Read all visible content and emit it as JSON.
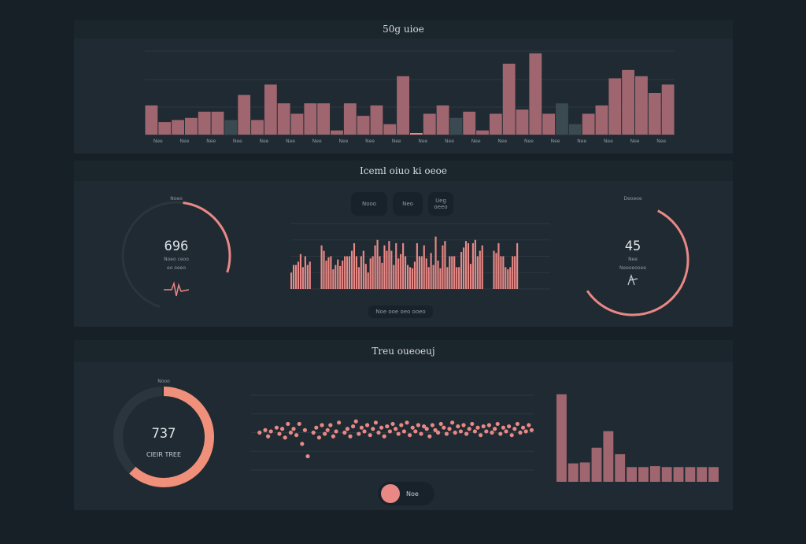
{
  "colors": {
    "background": "#182027",
    "panel": "#1f2a32",
    "bar": "#a06670",
    "bar_muted": "#3a4a50",
    "accent": "#e98885",
    "accent_orange": "#f0907a",
    "track": "#2a353c"
  },
  "panel1": {
    "title": "50g uioe"
  },
  "panel2": {
    "title": "Iceml oiuo ki oeoe",
    "gauge_left": {
      "label": "Noeo",
      "value": "696",
      "caption1": "Noeo ceoo",
      "caption2": "eo oeeo"
    },
    "gauge_right": {
      "label": "Deoeoe",
      "value": "45",
      "caption1": "Nee",
      "caption2": "Neeoeooee"
    },
    "buttons": [
      "Nooo",
      "Neo",
      "Ueg"
    ],
    "button_sub": "oeeo",
    "footer": "Noe ooe oeo ooeo"
  },
  "panel3": {
    "title": "Treu oueoeuj",
    "donut": {
      "label": "Nooo",
      "value": "737",
      "caption": "CIEIR TREE"
    },
    "toggle_label": "Noe"
  },
  "chart_data": [
    {
      "type": "bar",
      "title": "50g uioe",
      "ylim": [
        0,
        40
      ],
      "categories": [
        "Nee",
        "Nee",
        "Nee",
        "Nee",
        "Nee",
        "Nee",
        "Nee",
        "Nee",
        "Nee",
        "Nee",
        "Nee",
        "Nee",
        "Nee",
        "Nee",
        "Nee",
        "Nee",
        "Nee",
        "Nee",
        "Nee",
        "Nee"
      ],
      "values": [
        14,
        6,
        7,
        8,
        11,
        11,
        7,
        19,
        7,
        24,
        15,
        10,
        15,
        15,
        2,
        15,
        9,
        14,
        5,
        28,
        19,
        10,
        14,
        8,
        11,
        2,
        10,
        34,
        12,
        39,
        10,
        15,
        5,
        10,
        14,
        27,
        31,
        28,
        20,
        24
      ],
      "muted_indices": [
        6,
        23,
        31,
        32
      ],
      "highlight_index": 20,
      "grid": true
    },
    {
      "type": "bar",
      "ylim": [
        0,
        60
      ],
      "values": [
        15,
        22,
        22,
        25,
        32,
        20,
        30,
        22,
        25,
        40,
        35,
        26,
        29,
        30,
        18,
        22,
        27,
        21,
        26,
        30,
        30,
        30,
        35,
        42,
        30,
        20,
        30,
        35,
        23,
        15,
        28,
        30,
        40,
        45,
        30,
        24,
        40,
        35,
        44,
        35,
        22,
        42,
        28,
        32,
        42,
        30,
        22,
        20,
        19,
        25,
        42,
        30,
        30,
        40,
        28,
        20,
        33,
        22,
        48,
        26,
        19,
        40,
        44,
        20,
        30,
        30,
        30,
        20,
        20,
        34,
        38,
        44,
        42,
        23,
        42,
        45,
        30,
        35,
        40,
        35,
        33,
        42,
        30,
        30,
        20,
        18,
        20,
        30,
        30,
        42
      ],
      "gaps_after": [
        8,
        78
      ],
      "grid": true
    },
    {
      "type": "scatter",
      "ylim": [
        0,
        60
      ],
      "xlim": [
        0,
        100
      ],
      "points": [
        [
          3,
          30
        ],
        [
          5,
          32
        ],
        [
          6,
          27
        ],
        [
          7,
          31
        ],
        [
          9,
          34
        ],
        [
          10,
          29
        ],
        [
          11,
          33
        ],
        [
          12,
          26
        ],
        [
          13,
          37
        ],
        [
          14,
          30
        ],
        [
          15,
          33
        ],
        [
          16,
          28
        ],
        [
          17,
          37
        ],
        [
          18,
          21
        ],
        [
          19,
          32
        ],
        [
          20,
          11
        ],
        [
          22,
          30
        ],
        [
          23,
          34
        ],
        [
          24,
          26
        ],
        [
          25,
          36
        ],
        [
          26,
          29
        ],
        [
          27,
          32
        ],
        [
          28,
          36
        ],
        [
          29,
          27
        ],
        [
          30,
          31
        ],
        [
          31,
          38
        ],
        [
          33,
          30
        ],
        [
          34,
          33
        ],
        [
          35,
          27
        ],
        [
          36,
          35
        ],
        [
          37,
          39
        ],
        [
          38,
          29
        ],
        [
          39,
          34
        ],
        [
          40,
          31
        ],
        [
          41,
          36
        ],
        [
          42,
          28
        ],
        [
          43,
          33
        ],
        [
          44,
          38
        ],
        [
          45,
          30
        ],
        [
          46,
          34
        ],
        [
          47,
          27
        ],
        [
          48,
          35
        ],
        [
          49,
          31
        ],
        [
          50,
          37
        ],
        [
          51,
          33
        ],
        [
          52,
          29
        ],
        [
          53,
          36
        ],
        [
          54,
          31
        ],
        [
          55,
          38
        ],
        [
          56,
          28
        ],
        [
          57,
          34
        ],
        [
          58,
          31
        ],
        [
          59,
          36
        ],
        [
          60,
          29
        ],
        [
          61,
          35
        ],
        [
          62,
          33
        ],
        [
          63,
          27
        ],
        [
          64,
          36
        ],
        [
          65,
          32
        ],
        [
          66,
          30
        ],
        [
          67,
          37
        ],
        [
          68,
          34
        ],
        [
          69,
          29
        ],
        [
          70,
          33
        ],
        [
          71,
          38
        ],
        [
          72,
          30
        ],
        [
          73,
          35
        ],
        [
          74,
          31
        ],
        [
          75,
          36
        ],
        [
          76,
          29
        ],
        [
          77,
          33
        ],
        [
          78,
          37
        ],
        [
          79,
          31
        ],
        [
          80,
          34
        ],
        [
          81,
          28
        ],
        [
          82,
          35
        ],
        [
          83,
          31
        ],
        [
          84,
          36
        ],
        [
          85,
          30
        ],
        [
          86,
          33
        ],
        [
          87,
          37
        ],
        [
          88,
          29
        ],
        [
          89,
          34
        ],
        [
          90,
          31
        ],
        [
          91,
          35
        ],
        [
          92,
          28
        ],
        [
          93,
          33
        ],
        [
          94,
          37
        ],
        [
          95,
          30
        ],
        [
          96,
          34
        ],
        [
          97,
          31
        ],
        [
          98,
          36
        ],
        [
          99,
          32
        ]
      ],
      "grid": true
    },
    {
      "type": "bar",
      "ylim": [
        0,
        100
      ],
      "values": [
        95,
        20,
        21,
        37,
        55,
        30,
        16,
        16,
        17,
        16,
        16,
        16,
        16,
        16
      ]
    },
    {
      "type": "pie",
      "name": "gauge-left",
      "fraction": 0.28
    },
    {
      "type": "pie",
      "name": "gauge-right",
      "fraction": 0.58
    },
    {
      "type": "pie",
      "name": "donut",
      "fraction": 0.62
    }
  ]
}
